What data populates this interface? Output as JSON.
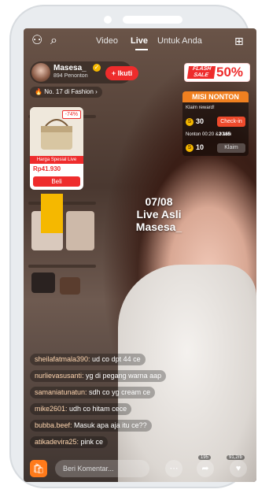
{
  "nav": {
    "tabs": [
      "Video",
      "Live",
      "Untuk Anda"
    ]
  },
  "host": {
    "name": "Masesa_",
    "viewers": "894 Penonton",
    "follow_label": "+ Ikuti",
    "rank": "No. 17 di Fashion"
  },
  "product_card": {
    "discount": "-74%",
    "label": "Harga Spesial Live",
    "price": "Rp41.930",
    "buy_label": "Beli"
  },
  "overlay_text": {
    "line1": "07/08",
    "line2": "Live Asli",
    "line3": "Masesa_"
  },
  "flash_sale": {
    "left_line1": "FLASH",
    "left_line2": "SALE",
    "percent": "50%"
  },
  "mission": {
    "title": "MISI NONTON",
    "subtitle": "Klaim reward!",
    "coin1": "30",
    "checkin_label": "Check-in",
    "row2": "Nonton 00:20 & Klaim",
    "coin2": "10",
    "claim_label": "Klaim",
    "mini_badges": "2  165"
  },
  "comments": [
    {
      "user": "sheilafatmala390:",
      "text": " ud co dpt 44 ce"
    },
    {
      "user": "nurlievasusanti:",
      "text": " yg di pegang warna aap"
    },
    {
      "user": "samaniatunatun:",
      "text": " sdh co yg cream ce"
    },
    {
      "user": "mike2601:",
      "text": " udh co hitam cece"
    },
    {
      "user": "bubba.beef:",
      "text": " Masuk apa aja itu ce??"
    },
    {
      "user": "atikadevira25:",
      "text": " pink ce"
    }
  ],
  "bottom_bar": {
    "comment_placeholder": "Beri Komentar...",
    "share_count": "195",
    "like_count": "91,2rb"
  }
}
